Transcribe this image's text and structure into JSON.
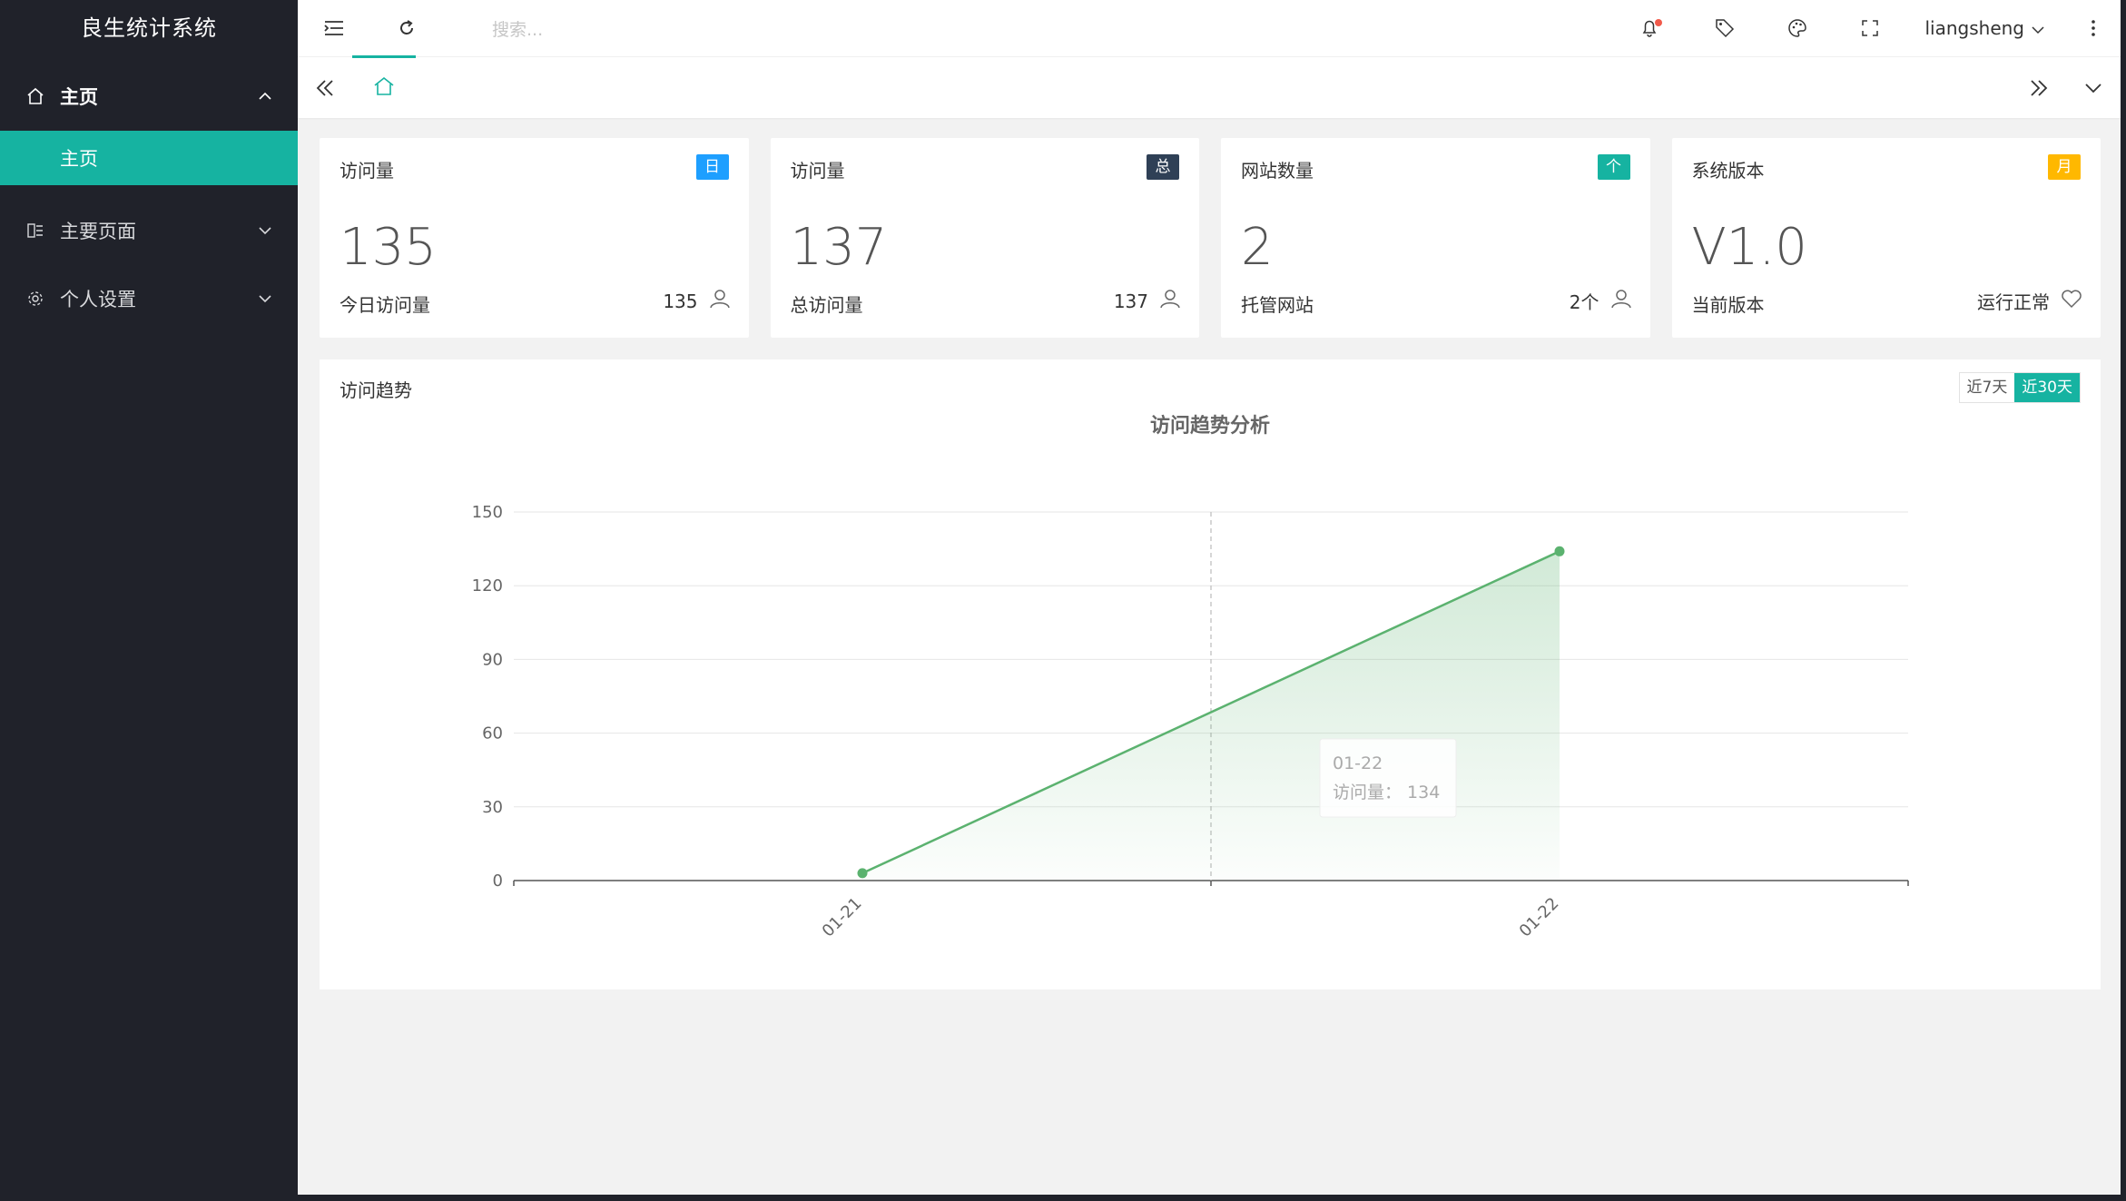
{
  "app": {
    "title": "良生统计系统"
  },
  "sidebar": {
    "items": [
      {
        "label": "主页",
        "open": true,
        "children": [
          {
            "label": "主页",
            "active": true
          }
        ]
      },
      {
        "label": "主要页面",
        "open": false
      },
      {
        "label": "个人设置",
        "open": false
      }
    ]
  },
  "topbar": {
    "search_placeholder": "搜索...",
    "username": "liangsheng",
    "notification_dot_color": "#f15a4a"
  },
  "colors": {
    "accent": "#16b3a1",
    "blue": "#1e9fff",
    "dark": "#2f4056",
    "orange": "#ffb800"
  },
  "cards": [
    {
      "title": "访问量",
      "badge": "日",
      "badge_color": "#1e9fff",
      "value": "135",
      "label": "今日访问量",
      "meta": "135",
      "meta_icon": "user-icon"
    },
    {
      "title": "访问量",
      "badge": "总",
      "badge_color": "#2f4056",
      "value": "137",
      "label": "总访问量",
      "meta": "137",
      "meta_icon": "user-icon"
    },
    {
      "title": "网站数量",
      "badge": "个",
      "badge_color": "#16b3a1",
      "value": "2",
      "label": "托管网站",
      "meta": "2个",
      "meta_icon": "user-icon"
    },
    {
      "title": "系统版本",
      "badge": "月",
      "badge_color": "#ffb800",
      "value": "V1.0",
      "label": "当前版本",
      "meta": "运行正常",
      "meta_icon": "heart-icon"
    }
  ],
  "panel": {
    "title": "访问趋势",
    "range_options": [
      "近7天",
      "近30天"
    ],
    "range_selected": "近30天"
  },
  "chart_data": {
    "type": "area",
    "title": "访问趋势分析",
    "categories": [
      "01-21",
      "01-22"
    ],
    "series": [
      {
        "values": [
          3,
          134
        ]
      }
    ],
    "ylim": [
      0,
      150
    ],
    "yticks": [
      0,
      30,
      60,
      90,
      120,
      150
    ],
    "grid": true,
    "line_color": "#5bb26f",
    "tooltip": {
      "category": "01-22",
      "label": "访问量：",
      "value": 134
    }
  }
}
